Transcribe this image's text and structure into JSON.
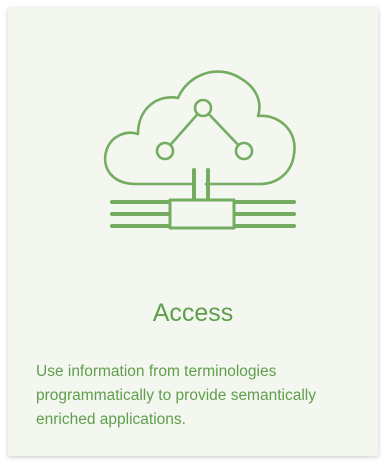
{
  "card": {
    "icon": "cloud-network-connector-icon",
    "title": "Access",
    "description": "Use information from terminologies programmatically to provide semantically enriched applications."
  },
  "colors": {
    "accent": "#5f9e4a",
    "card_background": "#f3f7f0",
    "page_background": "#ffffff"
  }
}
